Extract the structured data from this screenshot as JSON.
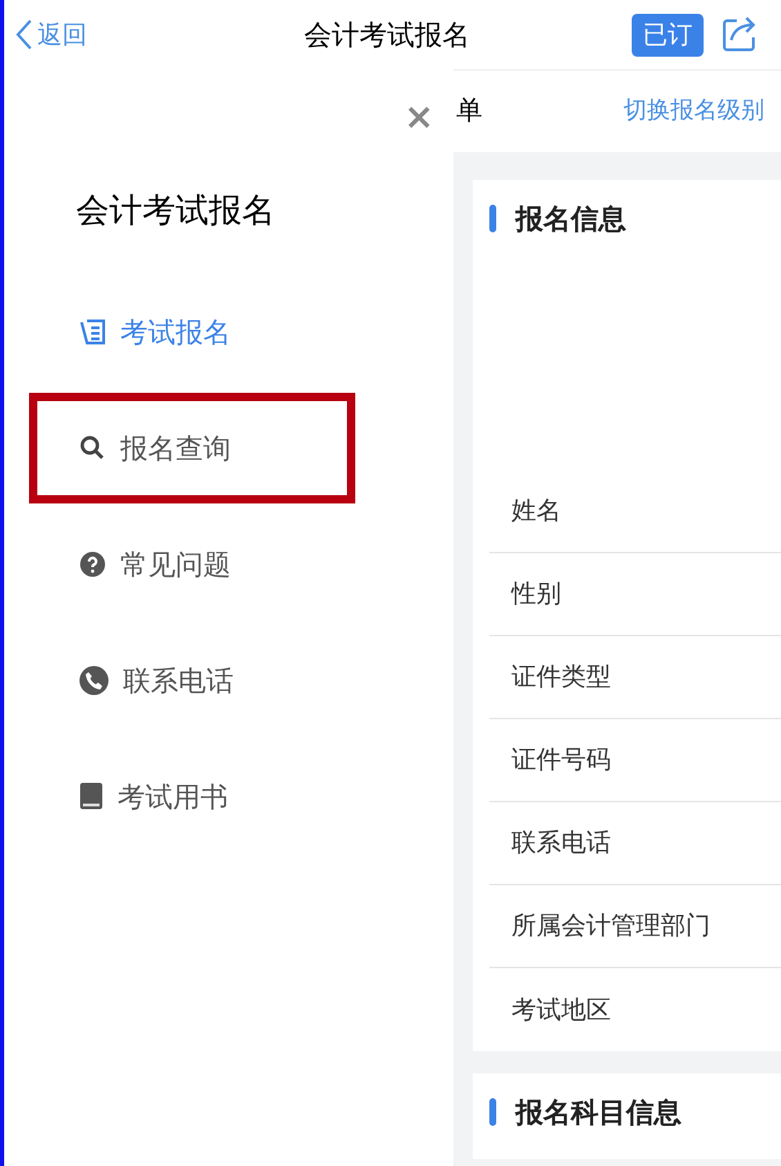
{
  "nav_bar": {
    "back": "返回",
    "title": "会计考试报名",
    "subscribe_badge": "已订"
  },
  "drawer": {
    "close": "×",
    "title": "会计考试报名",
    "items": [
      {
        "label": "考试报名",
        "selected": true,
        "highlighted": false
      },
      {
        "label": "报名查询",
        "selected": false,
        "highlighted": true
      },
      {
        "label": "常见问题",
        "selected": false,
        "highlighted": false
      },
      {
        "label": "联系电话",
        "selected": false,
        "highlighted": false
      },
      {
        "label": "考试用书",
        "selected": false,
        "highlighted": false
      }
    ]
  },
  "page": {
    "header_fragment": "单",
    "switch_link": "切换报名级别",
    "sections": [
      {
        "title": "报名信息",
        "fields": [
          "姓名",
          "性别",
          "证件类型",
          "证件号码",
          "联系电话",
          "所属会计管理部门",
          "考试地区"
        ]
      },
      {
        "title": "报名科目信息"
      }
    ]
  }
}
